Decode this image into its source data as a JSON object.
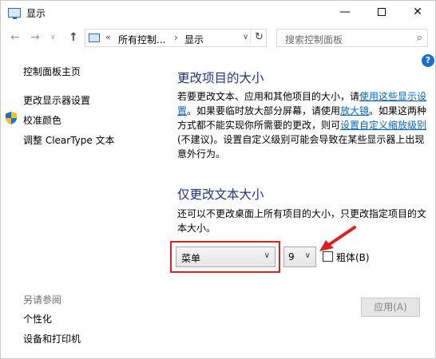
{
  "window": {
    "title": "显示",
    "minimize": "—",
    "close": "✕"
  },
  "nav": {
    "back": "←",
    "forward": "→",
    "recent": "∨",
    "up": "↑",
    "breadcrumb_chevron": "«",
    "breadcrumb": [
      "所有控制...",
      "显示"
    ],
    "breadcrumb_sep": "›",
    "address_dropdown": "∨",
    "refresh": "↻",
    "search_placeholder": "搜索控制面板"
  },
  "help": "?",
  "sidebar": {
    "home": "控制面板主页",
    "links": [
      "更改显示器设置",
      "校准颜色",
      "调整 ClearType 文本"
    ],
    "see_also_heading": "另请参阅",
    "see_also": [
      "个性化",
      "设备和打印机"
    ]
  },
  "main": {
    "heading1": "更改项目的大小",
    "para1": {
      "t1": "若要更改文本、应用和其他项目的大小，请",
      "link1": "使用这些显示设置",
      "t2": "。如果要临时放大部分屏幕，请使用",
      "link2": "放大镜",
      "t3": "。如果这两种方式都不能实现你所需要的更改，则可",
      "link3": "设置自定义缩放级别",
      "t4": "(不建议)。设置自定义级别可能会导致在某些显示器上出现意外行为。"
    },
    "heading2": "仅更改文本大小",
    "para2": "还可以不更改桌面上所有项目的大小，只更改指定项目的文本大小。",
    "item_select": "菜单",
    "size_select": "9",
    "select_chevron": "∨",
    "bold_label": "粗体(B)",
    "bold_checked": false,
    "apply": "应用(A)"
  },
  "colors": {
    "heading": "#1e3287",
    "link": "#0066cc",
    "annotation": "#e02020"
  }
}
